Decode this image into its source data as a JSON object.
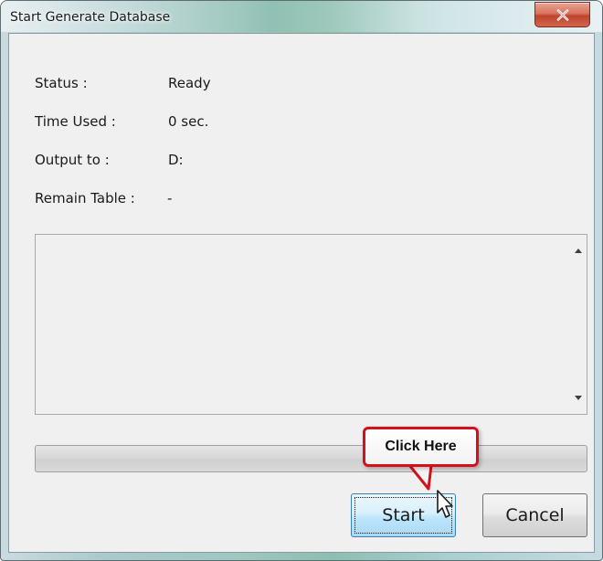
{
  "window": {
    "title": "Start Generate Database",
    "close_glyph": "x"
  },
  "info": {
    "status_label": "Status :",
    "status_value": "Ready",
    "time_label": "Time Used :",
    "time_value": "0 sec.",
    "output_label": "Output to :",
    "output_value": "D:",
    "remain_label": "Remain Table :",
    "remain_value": "-"
  },
  "log": {
    "text": ""
  },
  "progress": {
    "value": 0
  },
  "buttons": {
    "start_label": "Start",
    "cancel_label": "Cancel"
  },
  "annotation": {
    "callout_text": "Click Here",
    "callout_color": "#d3111d"
  },
  "icons": {
    "close": "close-icon",
    "scroll_up": "scroll-up-arrow-icon",
    "scroll_down": "scroll-down-arrow-icon",
    "cursor": "hand-pointer-cursor-icon"
  }
}
